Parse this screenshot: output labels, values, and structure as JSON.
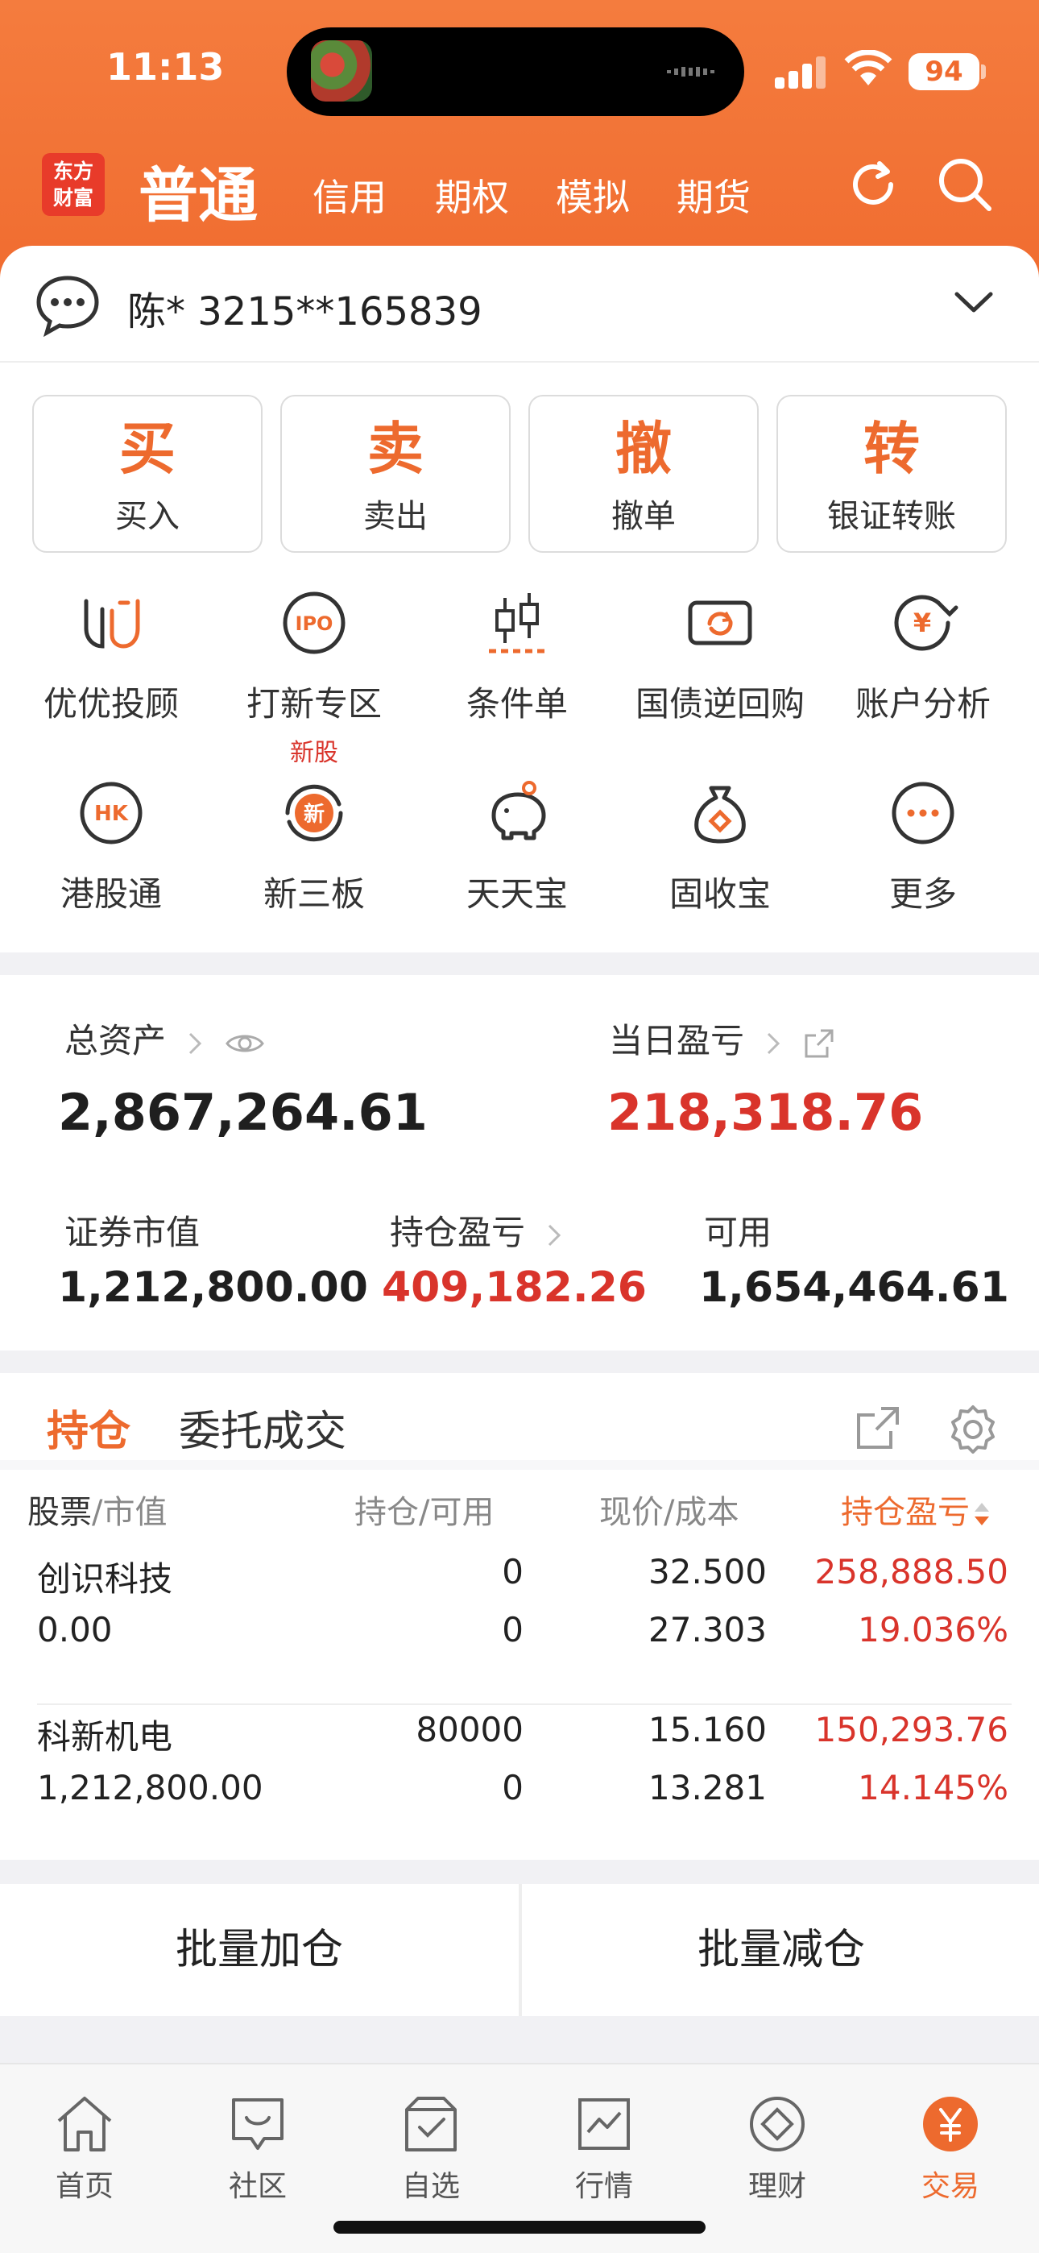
{
  "status_bar": {
    "time": "11:13",
    "battery": "94"
  },
  "header": {
    "logo_text": [
      "东方",
      "财富"
    ],
    "active_tab": "普通",
    "tabs": [
      "信用",
      "期权",
      "模拟",
      "期货"
    ]
  },
  "account": {
    "display": "陈*  3215**165839"
  },
  "quick_actions": [
    {
      "big": "买",
      "label": "买入"
    },
    {
      "big": "卖",
      "label": "卖出"
    },
    {
      "big": "撤",
      "label": "撤单"
    },
    {
      "big": "转",
      "label": "银证转账"
    }
  ],
  "functions": [
    {
      "label": "优优投顾",
      "icon": "advisor-icon"
    },
    {
      "label": "打新专区",
      "icon": "ipo-icon",
      "tag": "新股"
    },
    {
      "label": "条件单",
      "icon": "candlestick-icon"
    },
    {
      "label": "国债逆回购",
      "icon": "repo-icon"
    },
    {
      "label": "账户分析",
      "icon": "account-analysis-icon"
    },
    {
      "label": "港股通",
      "icon": "hk-icon"
    },
    {
      "label": "新三板",
      "icon": "neeq-icon"
    },
    {
      "label": "天天宝",
      "icon": "piggy-bank-icon"
    },
    {
      "label": "固收宝",
      "icon": "money-bag-icon"
    },
    {
      "label": "更多",
      "icon": "more-icon"
    }
  ],
  "assets": {
    "total_label": "总资产",
    "total_value": "2,867,264.61",
    "daily_pl_label": "当日盈亏",
    "daily_pl_value": "218,318.76",
    "market_value_label": "证券市值",
    "market_value": "1,212,800.00",
    "position_pl_label": "持仓盈亏",
    "position_pl_value": "409,182.26",
    "available_label": "可用",
    "available_value": "1,654,464.61"
  },
  "positions": {
    "tabs": [
      "持仓",
      "委托成交"
    ],
    "headers": {
      "stock": "股票",
      "market_value": "/市值",
      "hold": "持仓",
      "available": "/可用",
      "price": "现价",
      "cost": "/成本",
      "pl": "持仓盈亏"
    },
    "rows": [
      {
        "name": "创识科技",
        "market_value": "0.00",
        "hold": "0",
        "available": "0",
        "price": "32.500",
        "cost": "27.303",
        "pl": "258,888.50",
        "pl_pct": "19.036%"
      },
      {
        "name": "科新机电",
        "market_value": "1,212,800.00",
        "hold": "80000",
        "available": "0",
        "price": "15.160",
        "cost": "13.281",
        "pl": "150,293.76",
        "pl_pct": "14.145%"
      }
    ]
  },
  "batch": {
    "add": "批量加仓",
    "reduce": "批量减仓"
  },
  "tabbar": [
    {
      "label": "首页",
      "icon": "home-icon"
    },
    {
      "label": "社区",
      "icon": "community-icon"
    },
    {
      "label": "自选",
      "icon": "watchlist-icon"
    },
    {
      "label": "行情",
      "icon": "market-icon"
    },
    {
      "label": "理财",
      "icon": "wealth-icon"
    },
    {
      "label": "交易",
      "icon": "trade-icon"
    }
  ],
  "colors": {
    "brand_orange": "#ed6a2e",
    "profit_red": "#d9342b",
    "logo_red": "#e83b2a"
  }
}
